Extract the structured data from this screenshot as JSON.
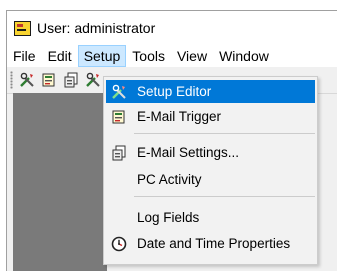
{
  "window": {
    "title": "User: administrator",
    "icon": "app-document-icon"
  },
  "menubar": {
    "items": [
      "File",
      "Edit",
      "Setup",
      "Tools",
      "View",
      "Window"
    ],
    "active": "Setup"
  },
  "toolbar": {
    "buttons": [
      "tools-icon",
      "trigger-doc-icon",
      "settings-doc-icon",
      "tools-icon"
    ]
  },
  "setup_menu": {
    "items": [
      {
        "label": "Setup Editor",
        "icon": "tools-icon",
        "highlighted": true
      },
      {
        "label": "E-Mail Trigger",
        "icon": "trigger-doc-icon"
      },
      {
        "label": "E-Mail Settings...",
        "icon": "settings-doc-icon"
      },
      {
        "label": "PC Activity",
        "icon": ""
      },
      {
        "label": "Log Fields",
        "icon": ""
      },
      {
        "label": "Date and Time Properties",
        "icon": "clock-icon"
      }
    ]
  },
  "colors": {
    "highlight": "#0078d7",
    "menu_active_bg": "#cce8ff",
    "workspace": "#7a7a7a"
  }
}
